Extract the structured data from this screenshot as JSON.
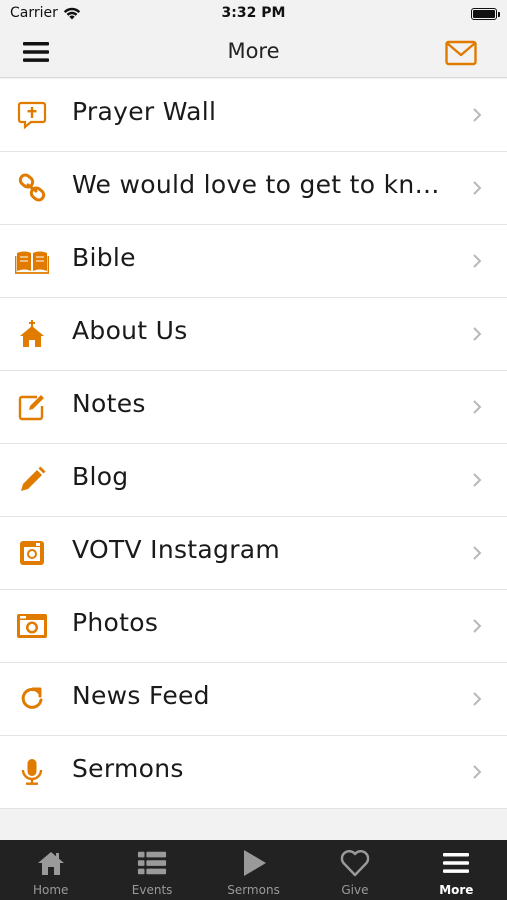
{
  "status_bar": {
    "carrier": "Carrier",
    "time": "3:32 PM"
  },
  "nav": {
    "title": "More"
  },
  "colors": {
    "accent": "#e07b00",
    "tab_bar_bg": "#222222",
    "tab_inactive": "#9a9a9a",
    "tab_active": "#ffffff"
  },
  "menu_items": [
    {
      "label": "Prayer Wall",
      "icon": "prayer-bubble-icon"
    },
    {
      "label": "We would love to get to kno…",
      "icon": "link-icon"
    },
    {
      "label": "Bible",
      "icon": "book-icon"
    },
    {
      "label": "About Us",
      "icon": "church-icon"
    },
    {
      "label": "Notes",
      "icon": "notes-edit-icon"
    },
    {
      "label": "Blog",
      "icon": "pencil-icon"
    },
    {
      "label": "VOTV Instagram",
      "icon": "instagram-icon"
    },
    {
      "label": "Photos",
      "icon": "camera-icon"
    },
    {
      "label": "News Feed",
      "icon": "refresh-icon"
    },
    {
      "label": "Sermons",
      "icon": "microphone-icon"
    }
  ],
  "tabs": [
    {
      "label": "Home",
      "icon": "home-icon"
    },
    {
      "label": "Events",
      "icon": "list-icon"
    },
    {
      "label": "Sermons",
      "icon": "play-icon"
    },
    {
      "label": "Give",
      "icon": "heart-icon"
    },
    {
      "label": "More",
      "icon": "menu-icon",
      "active": true
    }
  ]
}
